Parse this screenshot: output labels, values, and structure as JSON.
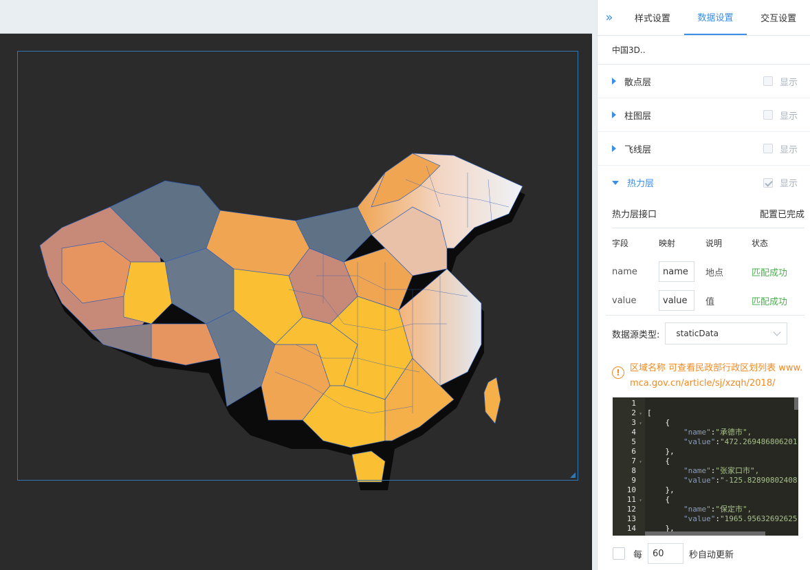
{
  "panel": {
    "collapse_icon": "double-chevron-right-icon",
    "tabs": [
      {
        "label": "样式设置",
        "active": false
      },
      {
        "label": "数据设置",
        "active": true
      },
      {
        "label": "交互设置",
        "active": false
      }
    ],
    "component_name": "中国3D..",
    "layers": [
      {
        "label": "散点层",
        "show_label": "显示",
        "checked": false,
        "expanded": false
      },
      {
        "label": "柱图层",
        "show_label": "显示",
        "checked": false,
        "expanded": false
      },
      {
        "label": "飞线层",
        "show_label": "显示",
        "checked": false,
        "expanded": false
      },
      {
        "label": "热力层",
        "show_label": "显示",
        "checked": true,
        "expanded": true
      }
    ],
    "heat": {
      "interface_label": "热力层接口",
      "interface_status": "配置已完成",
      "columns": [
        "字段",
        "映射",
        "说明",
        "状态"
      ],
      "fields": [
        {
          "field": "name",
          "mapping": "name",
          "desc": "地点",
          "status": "匹配成功"
        },
        {
          "field": "value",
          "mapping": "value",
          "desc": "值",
          "status": "匹配成功"
        }
      ],
      "datasource_label": "数据源类型:",
      "datasource_value": "staticData",
      "tip_line1": "区域名称 可查看民政部行政区划列表 www.",
      "tip_line2": "mca.gov.cn/article/sj/xzqh/2018/",
      "code_lines": [
        {
          "n": "1",
          "fold": "",
          "text": ""
        },
        {
          "n": "2",
          "fold": "▾",
          "text": "["
        },
        {
          "n": "3",
          "fold": "▾",
          "text": "    {"
        },
        {
          "n": "4",
          "fold": "",
          "key": "\"name\"",
          "val": "\"承德市\","
        },
        {
          "n": "5",
          "fold": "",
          "key": "\"value\"",
          "val": "\"472.269486806201"
        },
        {
          "n": "6",
          "fold": "",
          "text": "    },"
        },
        {
          "n": "7",
          "fold": "▾",
          "text": "    {"
        },
        {
          "n": "8",
          "fold": "",
          "key": "\"name\"",
          "val": "\"张家口市\","
        },
        {
          "n": "9",
          "fold": "",
          "key": "\"value\"",
          "val": "\"-125.82890802408"
        },
        {
          "n": "10",
          "fold": "",
          "text": "    },"
        },
        {
          "n": "11",
          "fold": "▾",
          "text": "    {"
        },
        {
          "n": "12",
          "fold": "",
          "key": "\"name\"",
          "val": "\"保定市\","
        },
        {
          "n": "13",
          "fold": "",
          "key": "\"value\"",
          "val": "\"1965.95632692625"
        },
        {
          "n": "14",
          "fold": "",
          "text": "    },"
        }
      ],
      "auto_update_prefix": "每",
      "auto_update_seconds": "60",
      "auto_update_suffix": "秒自动更新"
    }
  },
  "canvas": {
    "background": "#2b2b2b",
    "selection_color": "#2f78b4",
    "map_palette": [
      "#fbbf33",
      "#f0a553",
      "#e69561",
      "#c88a78",
      "#8a7f85",
      "#5f7185",
      "#6a788c",
      "#dce4ee",
      "#f6ecea"
    ]
  }
}
